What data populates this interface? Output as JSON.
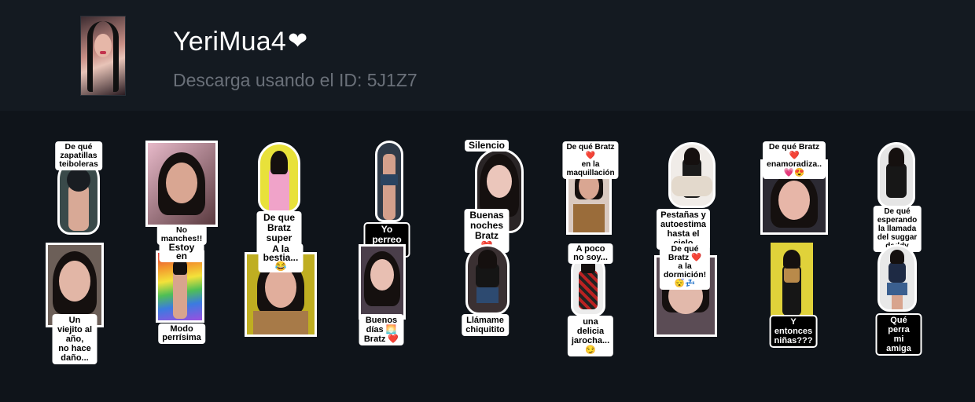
{
  "pack": {
    "title": "YeriMua4",
    "title_icon": "heart-icon",
    "title_icon_glyph": "❤",
    "subtitle": "Descarga usando el ID: 5J1Z7"
  },
  "stickers": [
    {
      "top": "De qué zapatillas\nteiboleras",
      "bottom": ""
    },
    {
      "top": "",
      "bottom": "No manches!!"
    },
    {
      "top": "",
      "bottom": "De que Bratz\nsuper virgen"
    },
    {
      "top": "",
      "bottom": "Yo perreo sola..."
    },
    {
      "top": "Silencio",
      "bottom": "Buenas noches\nBratz ❤️"
    },
    {
      "top": "De qué Bratz ❤️\nen la maquillación",
      "bottom": ""
    },
    {
      "top": "",
      "bottom": "Pestañas y autoestima\nhasta el cielo"
    },
    {
      "top": "De qué Bratz ❤️\nenamoradiza.. 💗😍",
      "bottom": ""
    },
    {
      "top": "",
      "bottom": "De qué esperando\nla llamada\ndel suggar daddy"
    },
    {
      "top": "",
      "bottom": "Un viejito al año,\nno hace daño..."
    },
    {
      "top": "Estoy en",
      "bottom": "Modo perrísima"
    },
    {
      "top": "A la bestia... 😂",
      "bottom": ""
    },
    {
      "top": "",
      "bottom": "Buenos días 🌅\nBratz ❤️"
    },
    {
      "top": "",
      "bottom": "Llámame\nchiquitito"
    },
    {
      "top": "A poco no soy...",
      "bottom": "una delicia\njarocha... 😏"
    },
    {
      "top": "De qué Bratz ❤️\na la dormición! 😴💤",
      "bottom": ""
    },
    {
      "top": "",
      "bottom": "Y entonces\nniñas???"
    },
    {
      "top": "",
      "bottom": "Qué perra\nmi amiga"
    }
  ]
}
